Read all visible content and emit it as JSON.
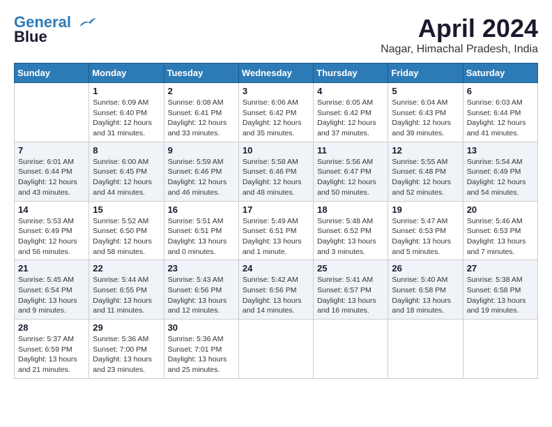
{
  "header": {
    "logo_line1": "General",
    "logo_line2": "Blue",
    "month": "April 2024",
    "location": "Nagar, Himachal Pradesh, India"
  },
  "calendar": {
    "weekdays": [
      "Sunday",
      "Monday",
      "Tuesday",
      "Wednesday",
      "Thursday",
      "Friday",
      "Saturday"
    ],
    "weeks": [
      [
        {
          "day": "",
          "info": ""
        },
        {
          "day": "1",
          "info": "Sunrise: 6:09 AM\nSunset: 6:40 PM\nDaylight: 12 hours\nand 31 minutes."
        },
        {
          "day": "2",
          "info": "Sunrise: 6:08 AM\nSunset: 6:41 PM\nDaylight: 12 hours\nand 33 minutes."
        },
        {
          "day": "3",
          "info": "Sunrise: 6:06 AM\nSunset: 6:42 PM\nDaylight: 12 hours\nand 35 minutes."
        },
        {
          "day": "4",
          "info": "Sunrise: 6:05 AM\nSunset: 6:42 PM\nDaylight: 12 hours\nand 37 minutes."
        },
        {
          "day": "5",
          "info": "Sunrise: 6:04 AM\nSunset: 6:43 PM\nDaylight: 12 hours\nand 39 minutes."
        },
        {
          "day": "6",
          "info": "Sunrise: 6:03 AM\nSunset: 6:44 PM\nDaylight: 12 hours\nand 41 minutes."
        }
      ],
      [
        {
          "day": "7",
          "info": "Sunrise: 6:01 AM\nSunset: 6:44 PM\nDaylight: 12 hours\nand 43 minutes."
        },
        {
          "day": "8",
          "info": "Sunrise: 6:00 AM\nSunset: 6:45 PM\nDaylight: 12 hours\nand 44 minutes."
        },
        {
          "day": "9",
          "info": "Sunrise: 5:59 AM\nSunset: 6:46 PM\nDaylight: 12 hours\nand 46 minutes."
        },
        {
          "day": "10",
          "info": "Sunrise: 5:58 AM\nSunset: 6:46 PM\nDaylight: 12 hours\nand 48 minutes."
        },
        {
          "day": "11",
          "info": "Sunrise: 5:56 AM\nSunset: 6:47 PM\nDaylight: 12 hours\nand 50 minutes."
        },
        {
          "day": "12",
          "info": "Sunrise: 5:55 AM\nSunset: 6:48 PM\nDaylight: 12 hours\nand 52 minutes."
        },
        {
          "day": "13",
          "info": "Sunrise: 5:54 AM\nSunset: 6:49 PM\nDaylight: 12 hours\nand 54 minutes."
        }
      ],
      [
        {
          "day": "14",
          "info": "Sunrise: 5:53 AM\nSunset: 6:49 PM\nDaylight: 12 hours\nand 56 minutes."
        },
        {
          "day": "15",
          "info": "Sunrise: 5:52 AM\nSunset: 6:50 PM\nDaylight: 12 hours\nand 58 minutes."
        },
        {
          "day": "16",
          "info": "Sunrise: 5:51 AM\nSunset: 6:51 PM\nDaylight: 13 hours\nand 0 minutes."
        },
        {
          "day": "17",
          "info": "Sunrise: 5:49 AM\nSunset: 6:51 PM\nDaylight: 13 hours\nand 1 minute."
        },
        {
          "day": "18",
          "info": "Sunrise: 5:48 AM\nSunset: 6:52 PM\nDaylight: 13 hours\nand 3 minutes."
        },
        {
          "day": "19",
          "info": "Sunrise: 5:47 AM\nSunset: 6:53 PM\nDaylight: 13 hours\nand 5 minutes."
        },
        {
          "day": "20",
          "info": "Sunrise: 5:46 AM\nSunset: 6:53 PM\nDaylight: 13 hours\nand 7 minutes."
        }
      ],
      [
        {
          "day": "21",
          "info": "Sunrise: 5:45 AM\nSunset: 6:54 PM\nDaylight: 13 hours\nand 9 minutes."
        },
        {
          "day": "22",
          "info": "Sunrise: 5:44 AM\nSunset: 6:55 PM\nDaylight: 13 hours\nand 11 minutes."
        },
        {
          "day": "23",
          "info": "Sunrise: 5:43 AM\nSunset: 6:56 PM\nDaylight: 13 hours\nand 12 minutes."
        },
        {
          "day": "24",
          "info": "Sunrise: 5:42 AM\nSunset: 6:56 PM\nDaylight: 13 hours\nand 14 minutes."
        },
        {
          "day": "25",
          "info": "Sunrise: 5:41 AM\nSunset: 6:57 PM\nDaylight: 13 hours\nand 16 minutes."
        },
        {
          "day": "26",
          "info": "Sunrise: 5:40 AM\nSunset: 6:58 PM\nDaylight: 13 hours\nand 18 minutes."
        },
        {
          "day": "27",
          "info": "Sunrise: 5:38 AM\nSunset: 6:58 PM\nDaylight: 13 hours\nand 19 minutes."
        }
      ],
      [
        {
          "day": "28",
          "info": "Sunrise: 5:37 AM\nSunset: 6:59 PM\nDaylight: 13 hours\nand 21 minutes."
        },
        {
          "day": "29",
          "info": "Sunrise: 5:36 AM\nSunset: 7:00 PM\nDaylight: 13 hours\nand 23 minutes."
        },
        {
          "day": "30",
          "info": "Sunrise: 5:36 AM\nSunset: 7:01 PM\nDaylight: 13 hours\nand 25 minutes."
        },
        {
          "day": "",
          "info": ""
        },
        {
          "day": "",
          "info": ""
        },
        {
          "day": "",
          "info": ""
        },
        {
          "day": "",
          "info": ""
        }
      ]
    ]
  }
}
